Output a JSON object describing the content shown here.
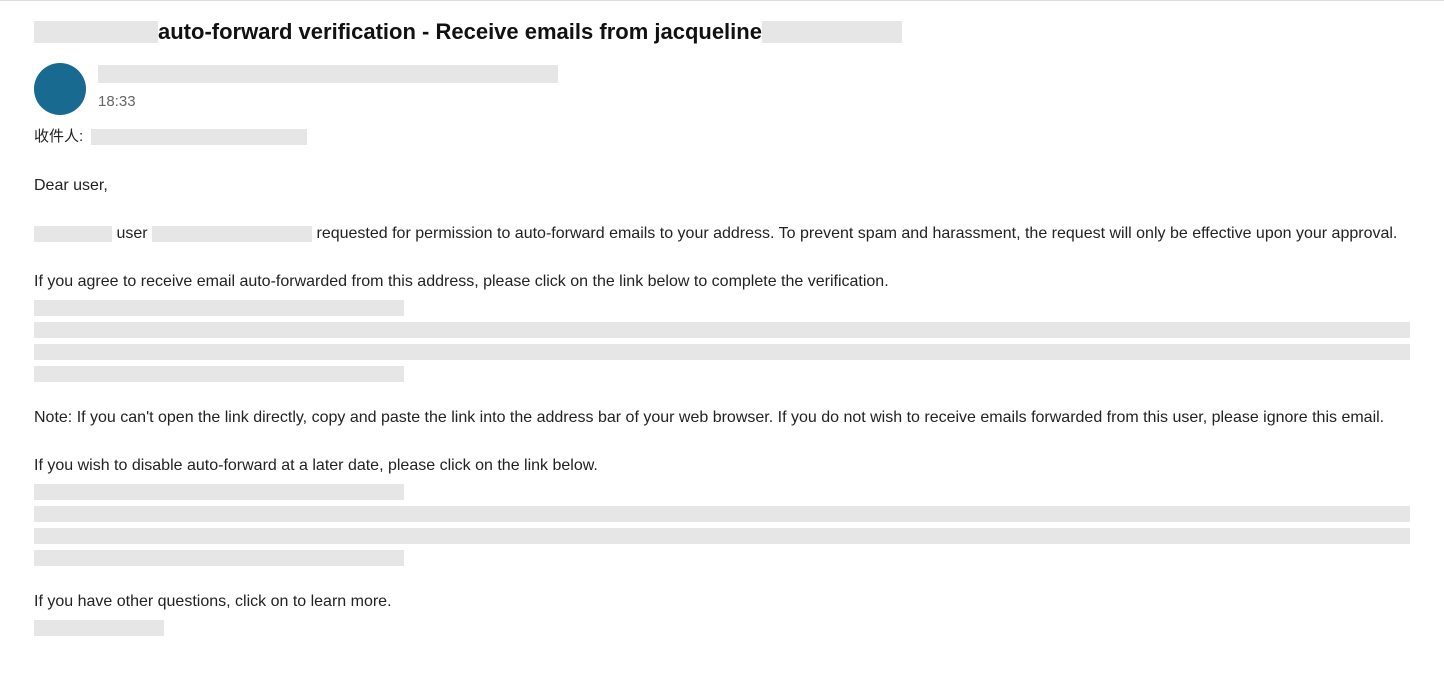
{
  "subject": {
    "mid": " auto-forward verification - Receive emails from jacqueline"
  },
  "meta": {
    "time": "18:33",
    "recipient_label": "收件人:"
  },
  "body": {
    "p1": "Dear user,",
    "p2_part1": "user",
    "p2_part2": " requested for permission to auto-forward emails to your address. To prevent spam and harassment, the request will only be effective upon your approval.",
    "p3": "If you agree to receive email auto-forwarded from this address, please click on the link below to complete the verification.",
    "p4": "Note: If you can't open the link directly, copy and paste the link into the address bar of your web browser. If you do not wish to receive emails forwarded from this user, please ignore this email.",
    "p5": "If you wish to disable auto-forward at a later date, please click on the link below.",
    "p6": "If you have other questions, click on to learn more."
  }
}
